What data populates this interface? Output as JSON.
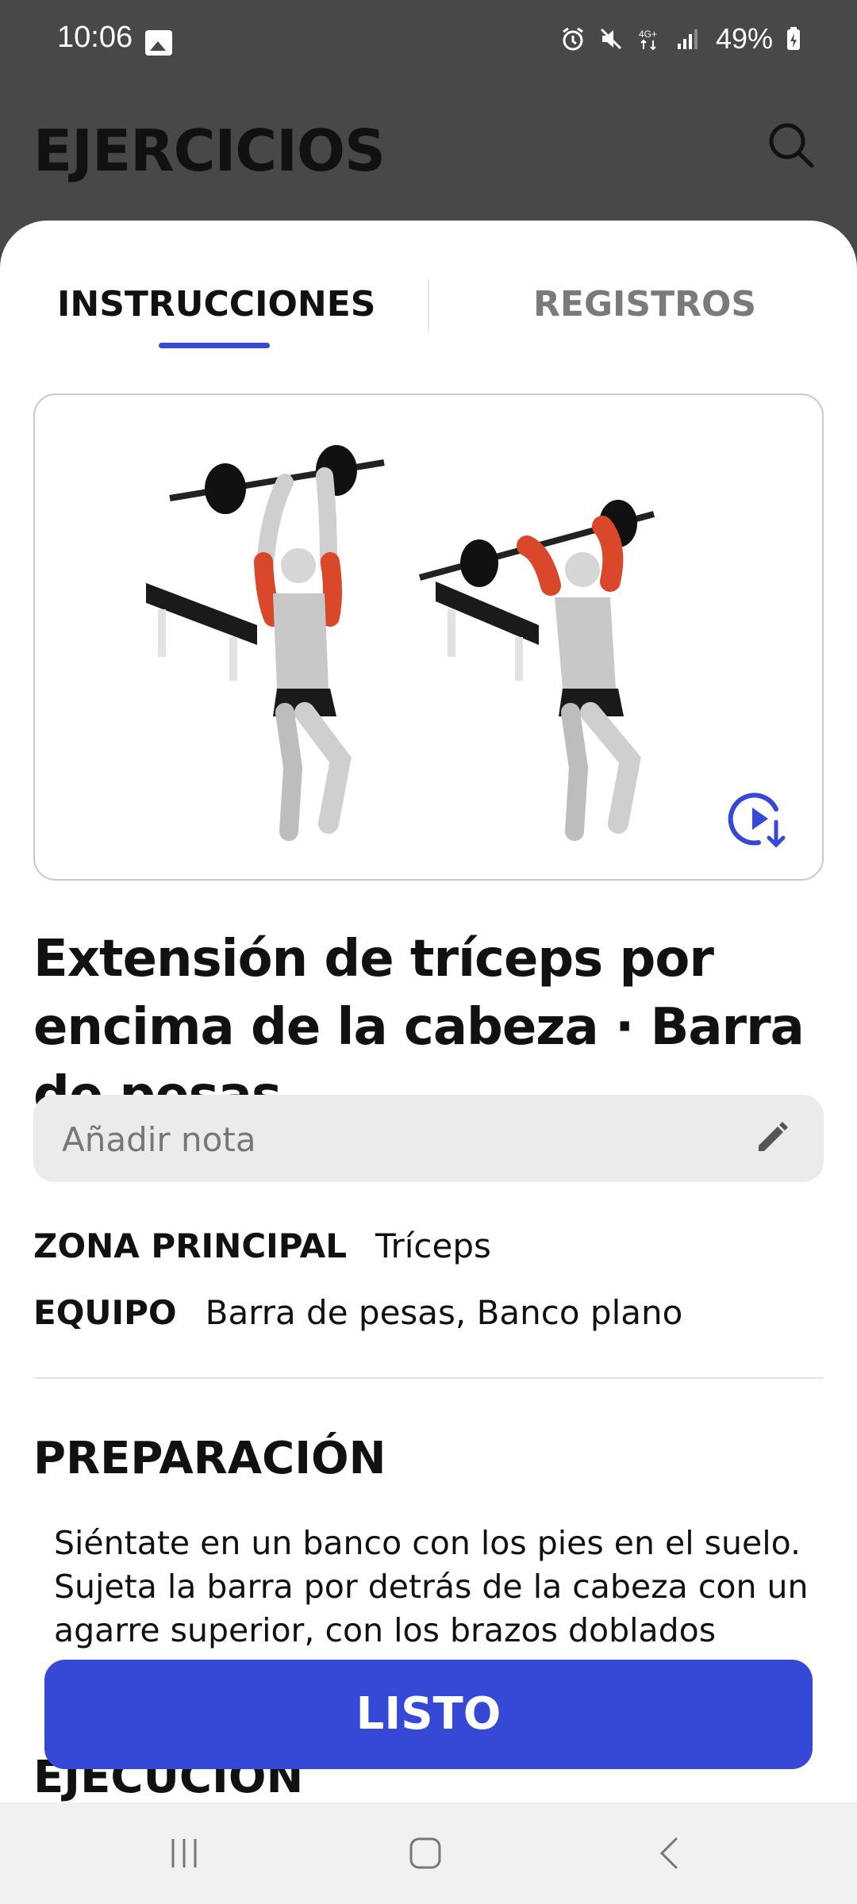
{
  "status_bar": {
    "time": "10:06",
    "battery": "49%",
    "icons": [
      "image-icon",
      "alarm-icon",
      "mute-icon",
      "4g-icon",
      "signal-icon",
      "battery-charging-icon"
    ]
  },
  "header": {
    "title": "EJERCICIOS"
  },
  "tabs": [
    {
      "label": "INSTRUCCIONES",
      "active": true
    },
    {
      "label": "REGISTROS",
      "active": false
    }
  ],
  "exercise": {
    "title": "Extensión de tríceps por encima de la cabeza · Barra de pesas",
    "note_placeholder": "Añadir nota",
    "primary_zone_label": "ZONA PRINCIPAL",
    "primary_zone_value": "Tríceps",
    "equipment_label": "EQUIPO",
    "equipment_value": "Barra de pesas, Banco plano"
  },
  "sections": {
    "preparation_title": "PREPARACIÓN",
    "preparation_text": "Siéntate en un banco con los pies en el suelo. Sujeta la barra por detrás de la cabeza con un agarre superior, con los brazos doblados",
    "execution_title": "EJECUCIÓN"
  },
  "done_button": "LISTO",
  "colors": {
    "accent": "#3549d6",
    "header_bg": "#484848",
    "muscle_highlight": "#d9482b"
  }
}
